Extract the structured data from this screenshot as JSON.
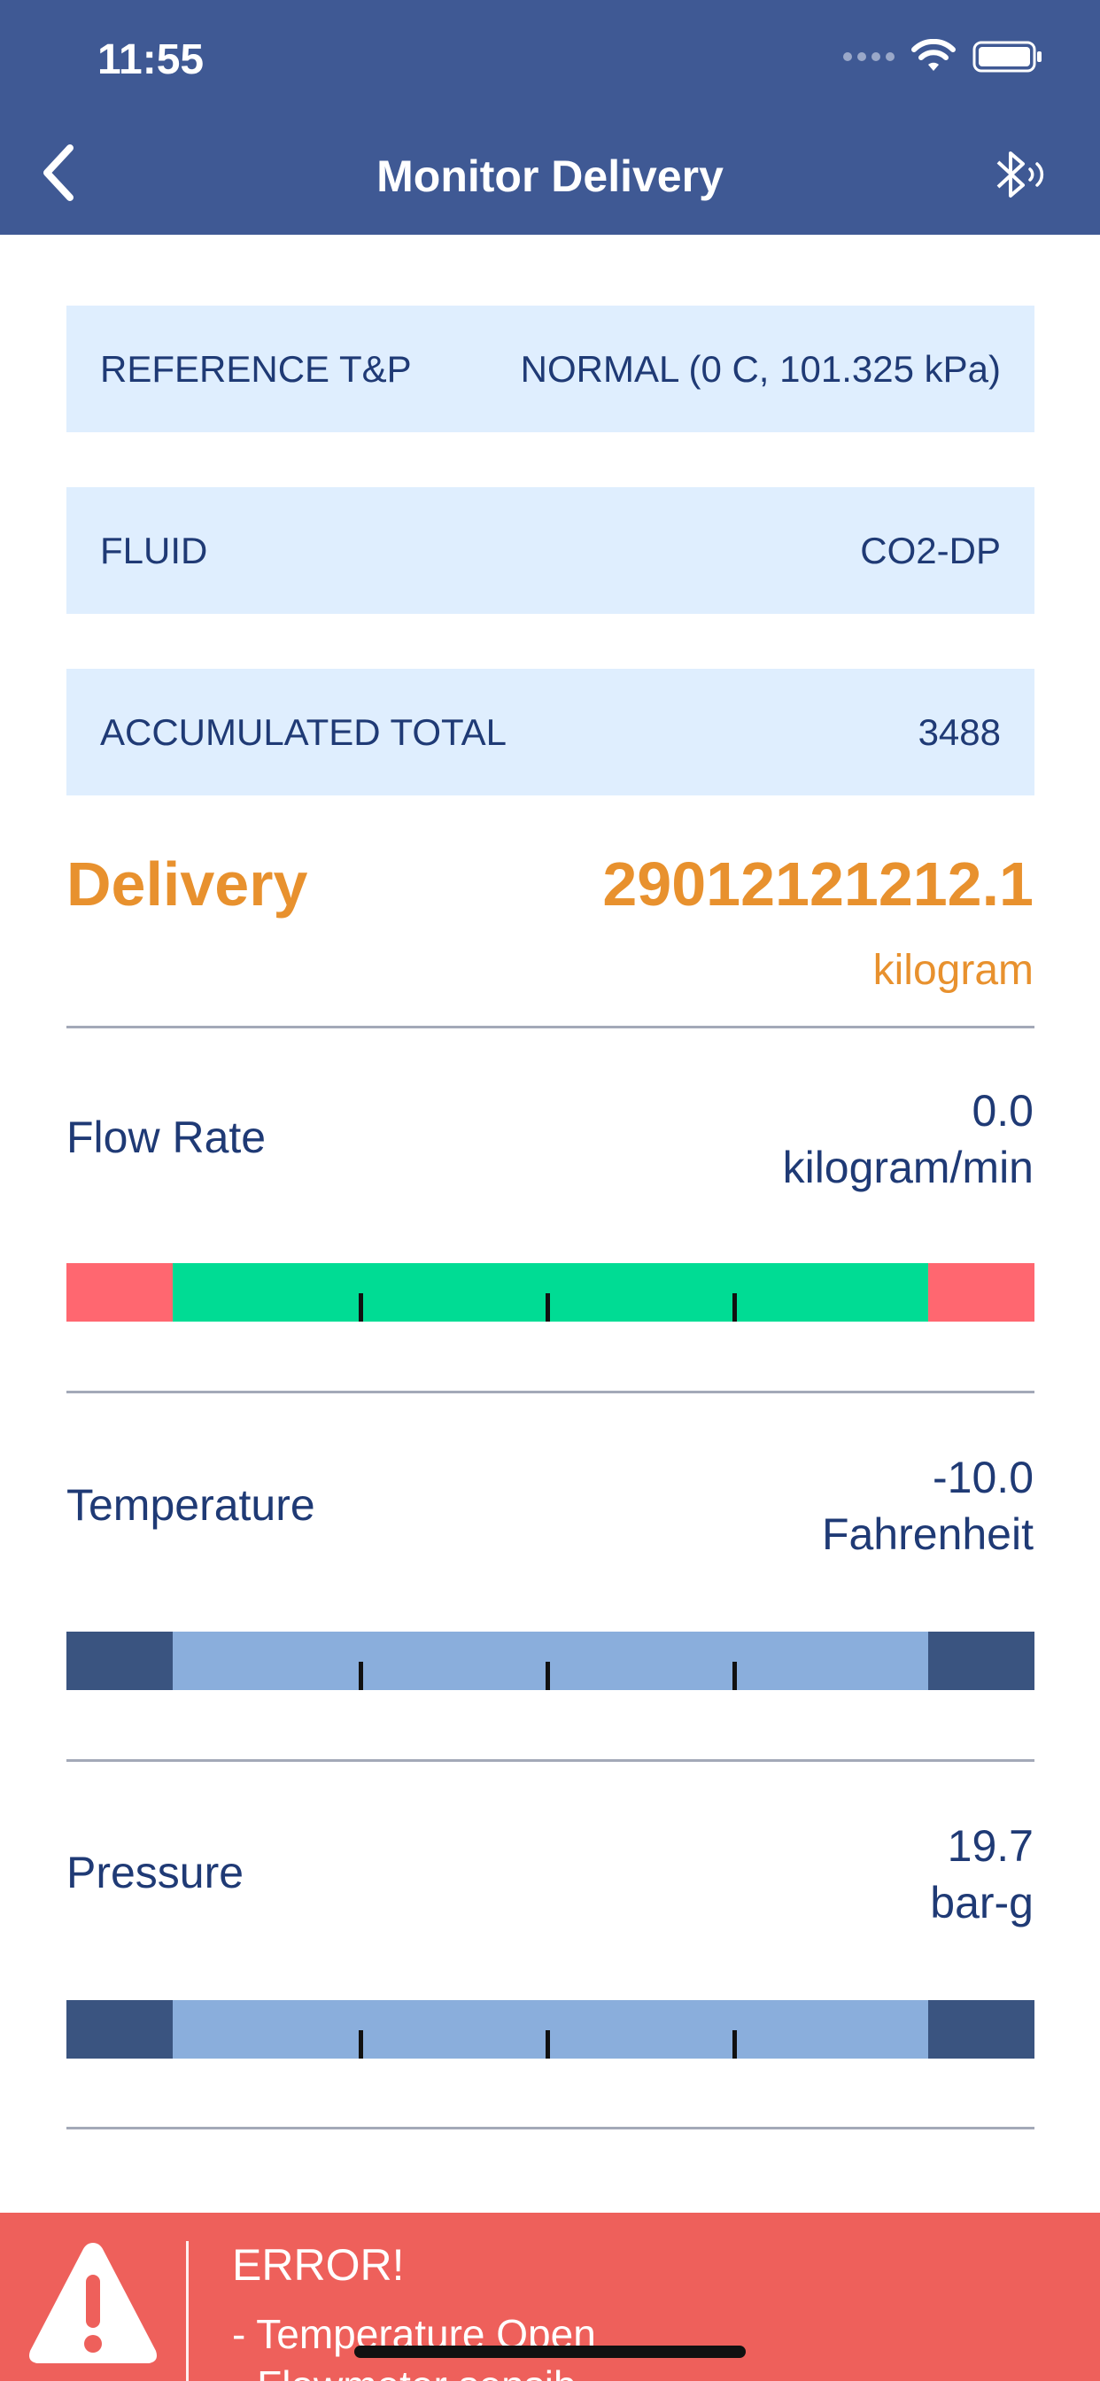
{
  "status_bar": {
    "time": "11:55"
  },
  "nav": {
    "title": "Monitor Delivery",
    "back_icon": "chevron-left-icon",
    "bluetooth_icon": "bluetooth-icon"
  },
  "info_rows": [
    {
      "label": "REFERENCE T&P",
      "value": "NORMAL (0 C, 101.325 kPa)"
    },
    {
      "label": "FLUID",
      "value": "CO2-DP"
    },
    {
      "label": "ACCUMULATED TOTAL",
      "value": "3488"
    }
  ],
  "delivery": {
    "label": "Delivery",
    "value": "29012121212.1",
    "unit": "kilogram",
    "color": "#e8912e"
  },
  "metrics": [
    {
      "label": "Flow Rate",
      "value": "0.0",
      "unit": "kilogram/min",
      "end_color": "#ff6770",
      "mid_color": "#00dc94"
    },
    {
      "label": "Temperature",
      "value": "-10.0",
      "unit": "Fahrenheit",
      "end_color": "#3a5480",
      "mid_color": "#8aaedc"
    },
    {
      "label": "Pressure",
      "value": "19.7",
      "unit": "bar-g",
      "end_color": "#3a5480",
      "mid_color": "#8aaedc"
    }
  ],
  "error": {
    "title": "ERROR!",
    "lines": [
      "- Temperature Open",
      "- Flowmeter sensib"
    ],
    "icon": "warning-triangle-icon",
    "color": "#ee605b"
  },
  "colors": {
    "primary": "#3f5994",
    "row_bg": "#dfeefe",
    "text": "#1f3a75"
  }
}
